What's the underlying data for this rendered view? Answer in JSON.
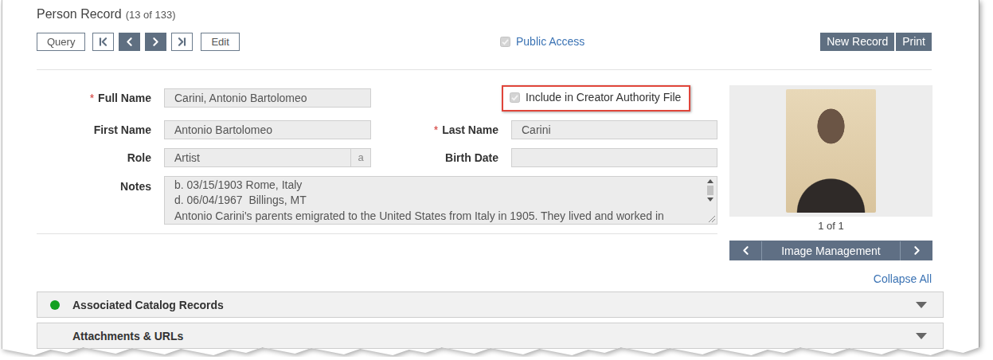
{
  "page": {
    "title": "Person Record",
    "count": "(13 of 133)"
  },
  "toolbar": {
    "query": "Query",
    "edit": "Edit",
    "public_access": {
      "label": "Public Access",
      "checked": true,
      "disabled": true
    },
    "actions": [
      "New Record",
      "Print"
    ]
  },
  "form": {
    "required_mark": "*",
    "left_fields": [
      {
        "label": "Full Name",
        "required": true,
        "value": "Carini, Antonio Bartolomeo"
      },
      {
        "label": "First Name",
        "required": false,
        "value": "Antonio Bartolomeo"
      },
      {
        "label": "Role",
        "required": false,
        "value": "Artist",
        "badge": "a"
      }
    ],
    "right_items": [
      {
        "kind": "checkbox",
        "label": "Include in Creator Authority File",
        "checked": true,
        "disabled": true,
        "highlighted": true
      },
      {
        "kind": "field",
        "label": "Last Name",
        "required": true,
        "value": "Carini"
      },
      {
        "kind": "field",
        "label": "Birth Date",
        "required": false,
        "value": ""
      }
    ],
    "notes": {
      "label": "Notes",
      "lines": [
        "b. 03/15/1903 Rome, Italy",
        "d. 06/04/1967  Billings, MT",
        "Antonio Carini's parents emigrated to the United States from Italy in 1905. They lived and worked in"
      ]
    }
  },
  "image": {
    "counter": "1 of 1",
    "bar_label": "Image Management"
  },
  "collapse_all": "Collapse All",
  "sections": [
    {
      "label": "Associated Catalog Records",
      "has_dot": true,
      "color": "#13a01f"
    },
    {
      "label": "Attachments & URLs",
      "has_dot": false,
      "color": "#13a01f"
    }
  ]
}
